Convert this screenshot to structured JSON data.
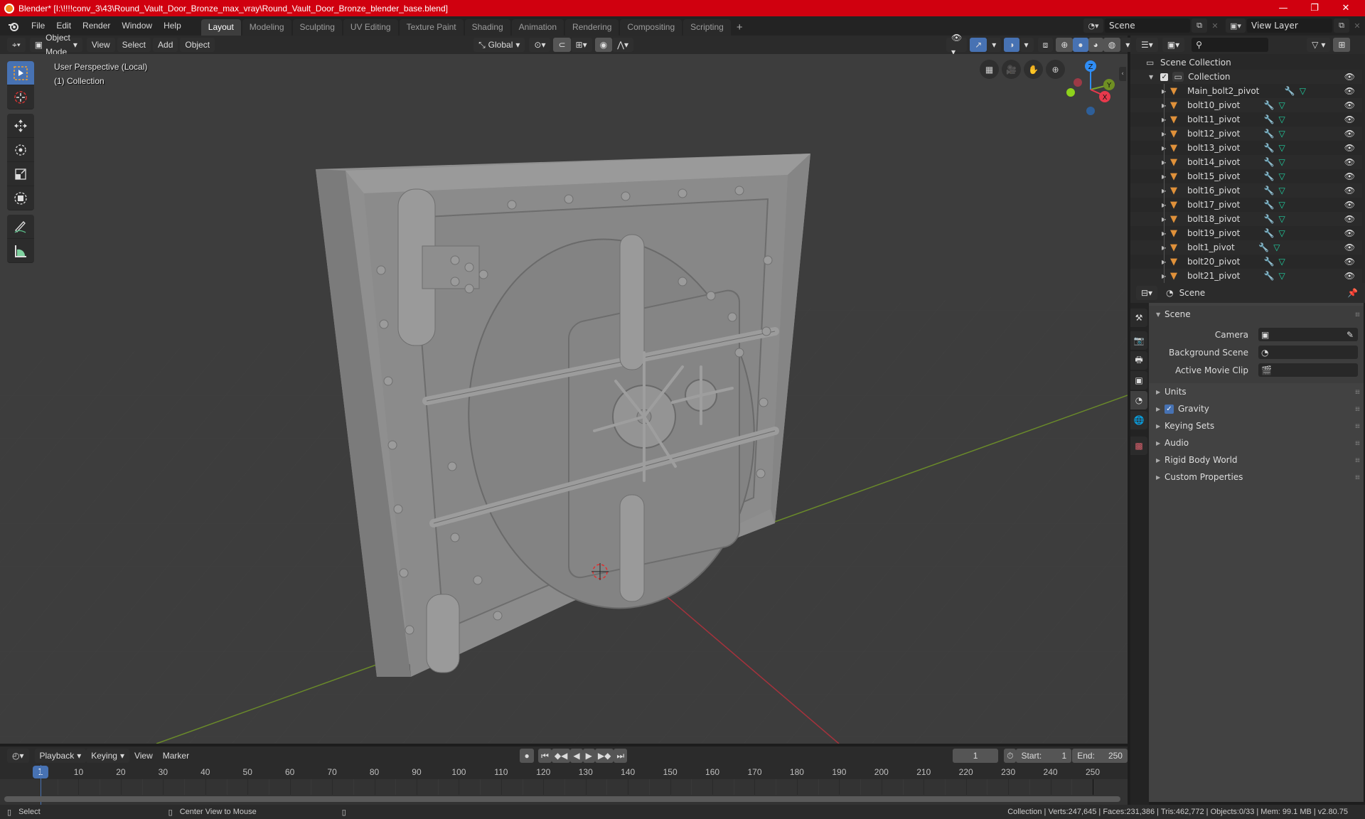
{
  "window": {
    "title": "Blender* [I:\\!!!!conv_3\\43\\Round_Vault_Door_Bronze_max_vray\\Round_Vault_Door_Bronze_blender_base.blend]",
    "controls": {
      "minimize": "—",
      "maximize": "❐",
      "close": "✕"
    }
  },
  "menubar": {
    "items": [
      "File",
      "Edit",
      "Render",
      "Window",
      "Help"
    ],
    "workspaces": [
      "Layout",
      "Modeling",
      "Sculpting",
      "UV Editing",
      "Texture Paint",
      "Shading",
      "Animation",
      "Rendering",
      "Compositing",
      "Scripting"
    ],
    "active_workspace": "Layout",
    "add_workspace": "+",
    "scene": "Scene",
    "view_layer": "View Layer"
  },
  "viewport_header": {
    "mode": "Object Mode",
    "menus": [
      "View",
      "Select",
      "Add",
      "Object"
    ],
    "orientation": "Global"
  },
  "viewport": {
    "perspective_label": "User Perspective (Local)",
    "collection_label": "(1) Collection",
    "gizmo": {
      "x": "X",
      "y": "Y",
      "z": "Z"
    },
    "tools": [
      "select-box",
      "cursor",
      "move",
      "rotate",
      "scale",
      "transform",
      "annotate",
      "measure"
    ],
    "colors": {
      "x_axis": "#e8394c",
      "y_axis": "#7ba42a",
      "z_axis": "#2f8df5",
      "background": "#3d3d3d",
      "model": "#8a8a8a"
    }
  },
  "outliner": {
    "search_placeholder": "",
    "root": "Scene Collection",
    "collection": "Collection",
    "objects": [
      "Main_bolt2_pivot",
      "bolt10_pivot",
      "bolt11_pivot",
      "bolt12_pivot",
      "bolt13_pivot",
      "bolt14_pivot",
      "bolt15_pivot",
      "bolt16_pivot",
      "bolt17_pivot",
      "bolt18_pivot",
      "bolt19_pivot",
      "bolt1_pivot",
      "bolt20_pivot",
      "bolt21_pivot"
    ]
  },
  "properties": {
    "context": "Scene",
    "panel_title": "Scene",
    "fields": [
      {
        "label": "Camera",
        "value": ""
      },
      {
        "label": "Background Scene",
        "value": ""
      },
      {
        "label": "Active Movie Clip",
        "value": ""
      }
    ],
    "sections": [
      {
        "label": "Units",
        "checkbox": false
      },
      {
        "label": "Gravity",
        "checkbox": true,
        "checked": true
      },
      {
        "label": "Keying Sets",
        "checkbox": false
      },
      {
        "label": "Audio",
        "checkbox": false
      },
      {
        "label": "Rigid Body World",
        "checkbox": false
      },
      {
        "label": "Custom Properties",
        "checkbox": false
      }
    ]
  },
  "timeline": {
    "menus": [
      "Playback",
      "Keying",
      "View",
      "Marker"
    ],
    "current_frame": "1",
    "start_label": "Start:",
    "start": "1",
    "end_label": "End:",
    "end": "250",
    "ticks": [
      "10",
      "20",
      "30",
      "40",
      "50",
      "60",
      "70",
      "80",
      "90",
      "100",
      "110",
      "120",
      "130",
      "140",
      "150",
      "160",
      "170",
      "180",
      "190",
      "200",
      "210",
      "220",
      "230",
      "240",
      "250"
    ],
    "current_marker": "1"
  },
  "statusbar": {
    "left": [
      "Select",
      "Center View to Mouse"
    ],
    "right": "Collection | Verts:247,645 | Faces:231,386 | Tris:462,772 | Objects:0/33 | Mem: 99.1 MB | v2.80.75"
  }
}
